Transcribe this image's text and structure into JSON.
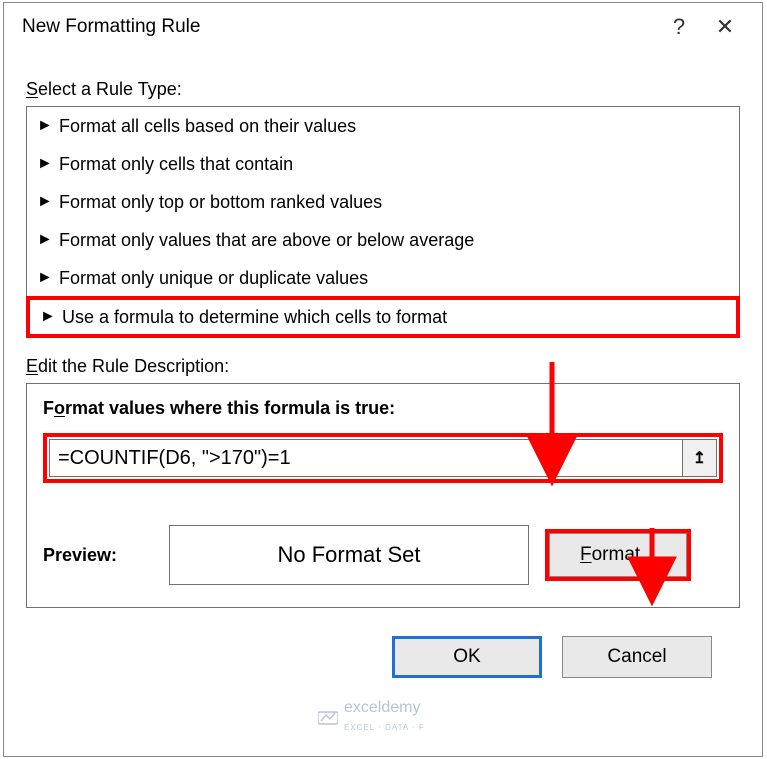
{
  "dialog": {
    "title": "New Formatting Rule",
    "help_char": "?",
    "close_char": "✕"
  },
  "sections": {
    "rule_type_label": "Select a Rule Type:",
    "rule_type_first": "S",
    "desc_label": "Edit the Rule Description:",
    "desc_first": "E"
  },
  "rules": [
    "Format all cells based on their values",
    "Format only cells that contain",
    "Format only top or bottom ranked values",
    "Format only values that are above or below average",
    "Format only unique or duplicate values",
    "Use a formula to determine which cells to format"
  ],
  "selected_rule_index": 5,
  "desc": {
    "title": "Format values where this formula is true:",
    "title_first": "o",
    "formula": "=COUNTIF(D6, \">170\")=1",
    "collapse_glyph": "↥",
    "preview_label": "Preview:",
    "preview_text": "No Format Set",
    "format_label": "Format...",
    "format_first": "F"
  },
  "footer": {
    "ok": "OK",
    "cancel": "Cancel"
  },
  "watermark": {
    "brand": "exceldemy",
    "sub": "EXCEL · DATA · F"
  }
}
